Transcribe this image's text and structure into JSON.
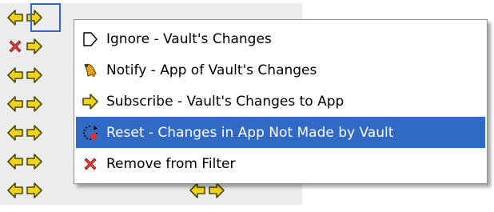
{
  "menu": {
    "items": [
      {
        "label": "Ignore - Vault's Changes",
        "icon": "ignore-tag-icon"
      },
      {
        "label": "Notify - App of Vault's Changes",
        "icon": "bell-icon"
      },
      {
        "label": "Subscribe - Vault's Changes to App",
        "icon": "arrow-right-icon"
      },
      {
        "label": "Reset - Changes in App Not Made by Vault",
        "icon": "reset-icon",
        "highlighted": true
      },
      {
        "label": "Remove from Filter",
        "icon": "red-x-icon"
      }
    ]
  },
  "colors": {
    "highlight": "#316ac5",
    "arrow_fill": "#f3d21b",
    "arrow_outline": "#4a4a00",
    "red_x": "#e23b3b",
    "grid_bg": "#ececec",
    "selection_border": "#3566c4"
  }
}
